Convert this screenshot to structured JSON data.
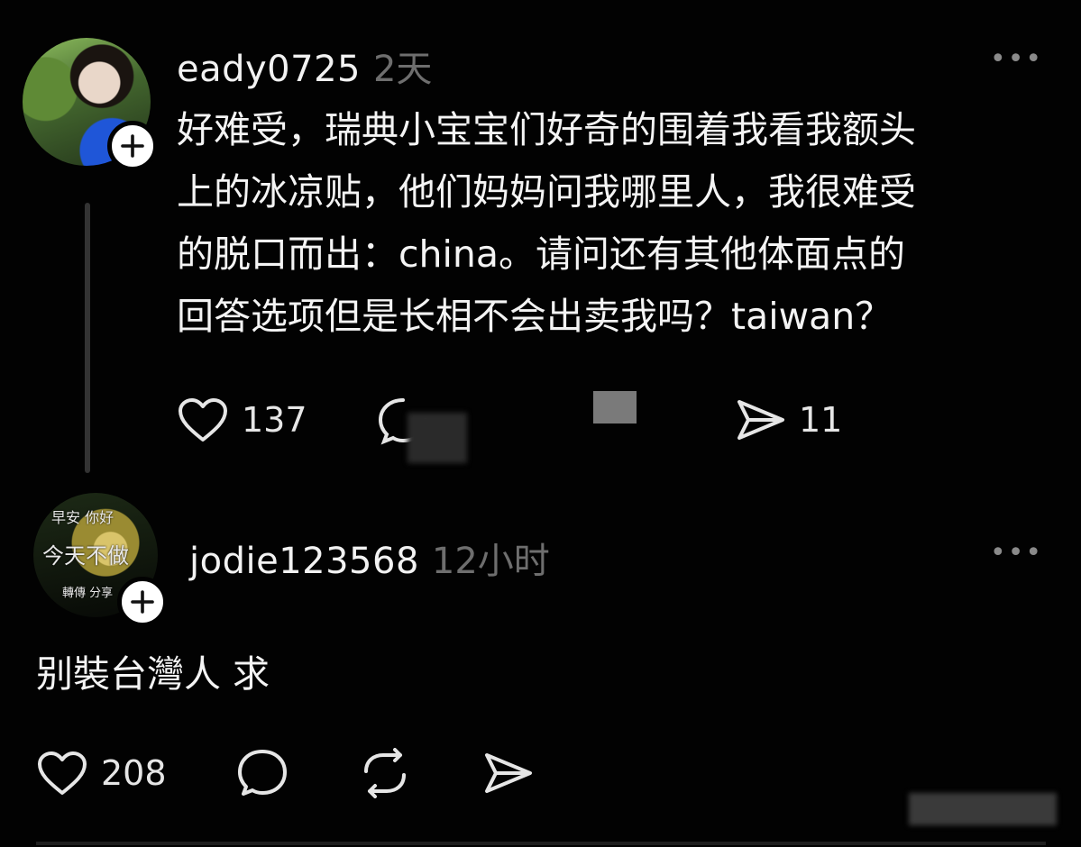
{
  "post": {
    "username": "eady0725",
    "time": "2天",
    "text": "好难受，瑞典小宝宝们好奇的围着我看我额头\n上的冰凉贴，他们妈妈问我哪里人，我很难受\n的脱口而出：china。请问还有其他体面点的\n回答选项但是长相不会出卖我吗？taiwan？",
    "likes": "137",
    "shares": "11",
    "icons": [
      "heart-icon",
      "comment-icon",
      "send-icon",
      "more-icon",
      "plus-icon"
    ]
  },
  "reply": {
    "username": "jodie123568",
    "time": "12小时",
    "text": "别裝台灣人 求",
    "likes": "208",
    "avatar_text": {
      "top": "早安 你好",
      "middle": "今天不做",
      "bottom": "轉傳 分享"
    },
    "icons": [
      "heart-icon",
      "comment-icon",
      "repost-icon",
      "send-icon",
      "more-icon",
      "plus-icon"
    ]
  },
  "colors": {
    "background": "#020202",
    "text": "#f4f4f4",
    "muted": "#6e6e6e"
  }
}
